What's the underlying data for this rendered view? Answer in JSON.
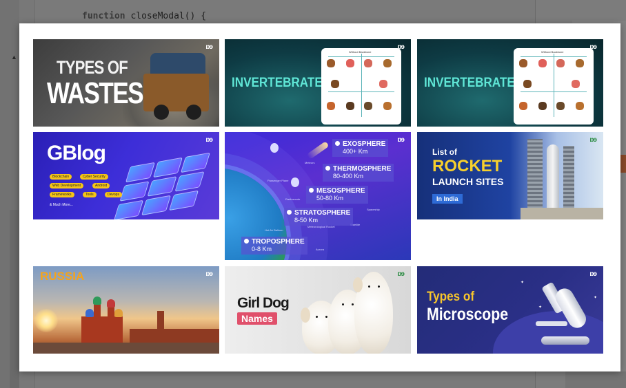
{
  "editor": {
    "code_keyword": "function",
    "code_rest": " closeModal() {"
  },
  "gallery": {
    "logo_text": "ɒɘ",
    "tiles": {
      "wastes": {
        "line1": "TYPES OF",
        "line2": "WASTES"
      },
      "invertebrates_1": {
        "title": "INVERTEBRATES",
        "panel_heading": "Without Backbone"
      },
      "invertebrates_2": {
        "title": "INVERTEBRATES",
        "panel_heading": "Without Backbone"
      },
      "gblog": {
        "title": "GBlog",
        "chips": [
          "Blockchain",
          "Cyber Security",
          "Web Development",
          "Android",
          "Frameworks",
          "Tools",
          "Devops"
        ],
        "more": "& Much More..."
      },
      "atmosphere": {
        "layers": [
          {
            "name": "EXOSPHERE",
            "range": "400+ Km"
          },
          {
            "name": "THERMOSPHERE",
            "range": "80-400 Km"
          },
          {
            "name": "MESOSPHERE",
            "range": "50-80 Km"
          },
          {
            "name": "STRATOSPHERE",
            "range": "8-50 Km"
          },
          {
            "name": "TROPOSPHERE",
            "range": "0-8 Km"
          }
        ],
        "mini_labels": [
          "Meteors",
          "Passenger Plane",
          "Radiosonde",
          "Spaceship",
          "Satellite",
          "Hot Air Balloon",
          "Meteorological Rocket",
          "Aurora"
        ]
      },
      "rocket": {
        "line1": "List of",
        "line2": "ROCKET",
        "line3": "LAUNCH SITES",
        "badge": "In India"
      },
      "russia": {
        "title": "RUSSIA"
      },
      "dogs": {
        "line1": "Girl Dog",
        "badge": "Names"
      },
      "microscope": {
        "line1": "Types of",
        "line2": "Microscope"
      }
    }
  }
}
